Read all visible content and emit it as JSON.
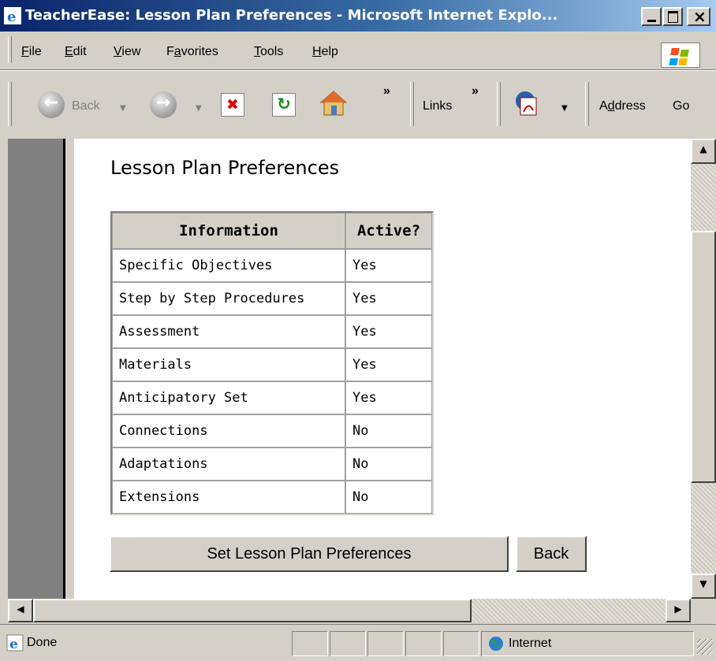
{
  "window": {
    "title": "TeacherEase: Lesson Plan Preferences - Microsoft Internet Explo..."
  },
  "menubar": {
    "items": [
      {
        "label": "File",
        "u": "F",
        "rest": "ile"
      },
      {
        "label": "Edit",
        "u": "E",
        "rest": "dit"
      },
      {
        "label": "View",
        "u": "V",
        "rest": "iew"
      },
      {
        "label": "Favorites",
        "pre": "F",
        "u": "a",
        "rest": "vorites"
      },
      {
        "label": "Tools",
        "u": "T",
        "rest": "ools"
      },
      {
        "label": "Help",
        "u": "H",
        "rest": "elp"
      }
    ]
  },
  "toolbar": {
    "back_label": "Back",
    "chevron": "»",
    "links_label": "Links",
    "address_pre": "A",
    "address_u": "d",
    "address_rest": "dress",
    "go_label": "Go"
  },
  "page": {
    "title": "Lesson Plan Preferences",
    "table": {
      "headers": [
        "Information",
        "Active?"
      ],
      "rows": [
        [
          "Specific Objectives",
          "Yes"
        ],
        [
          "Step by Step Procedures",
          "Yes"
        ],
        [
          "Assessment",
          "Yes"
        ],
        [
          "Materials",
          "Yes"
        ],
        [
          "Anticipatory Set",
          "Yes"
        ],
        [
          "Connections",
          "No"
        ],
        [
          "Adaptations",
          "No"
        ],
        [
          "Extensions",
          "No"
        ]
      ]
    },
    "set_button": "Set Lesson Plan Preferences",
    "back_button": "Back"
  },
  "statusbar": {
    "status": "Done",
    "zone": "Internet"
  },
  "icons": [
    "ie-icon",
    "back-arrow-icon",
    "forward-arrow-icon",
    "stop-icon",
    "refresh-icon",
    "home-icon",
    "pdf-icon",
    "windows-logo-icon",
    "globe-icon"
  ],
  "colors": {
    "titlebar_start": "#0a246a",
    "titlebar_end": "#a6caf0",
    "chrome": "#d4d0c8"
  }
}
